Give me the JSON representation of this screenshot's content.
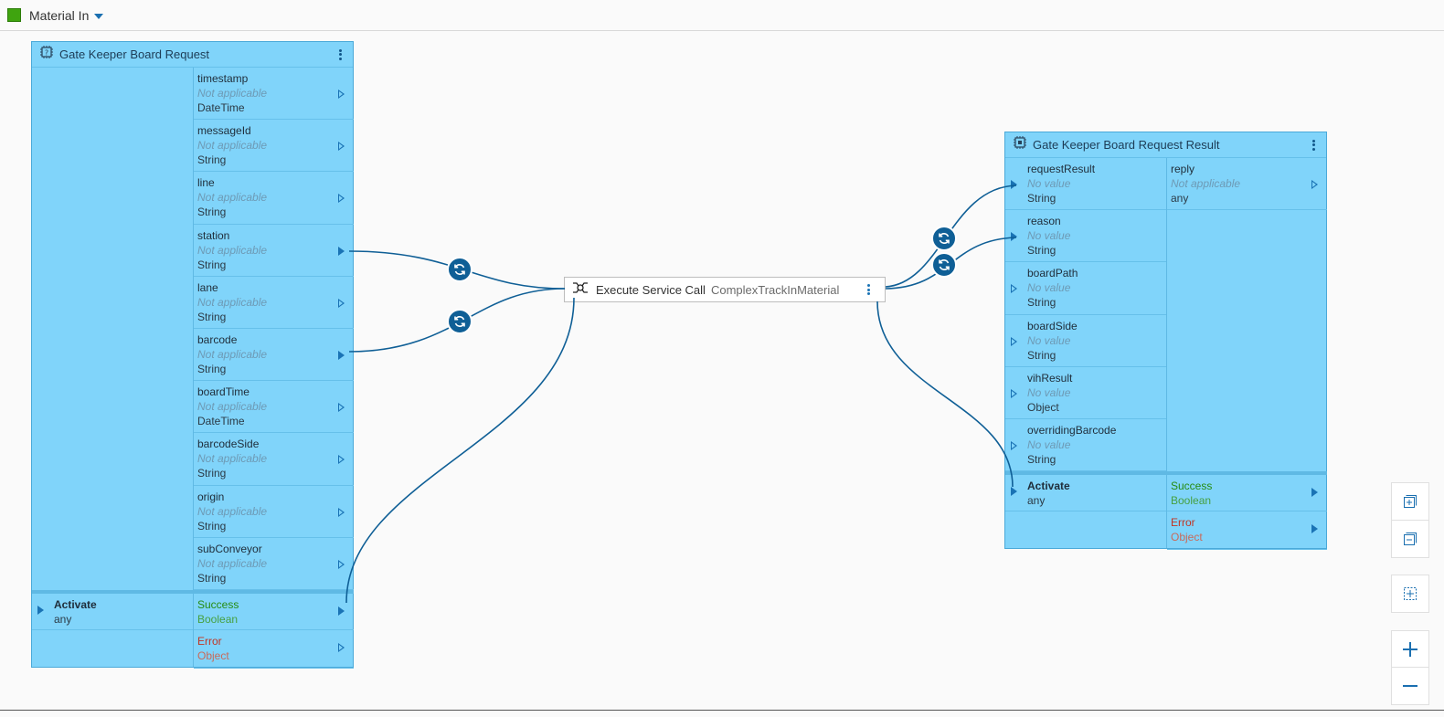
{
  "flow": {
    "name": "Material In",
    "swatch_color": "#3fa40f"
  },
  "left_task": {
    "title": "Gate Keeper Board Request",
    "outputs": [
      {
        "name": "timestamp",
        "value": "Not applicable",
        "type": "DateTime",
        "connected": false
      },
      {
        "name": "messageId",
        "value": "Not applicable",
        "type": "String",
        "connected": false
      },
      {
        "name": "line",
        "value": "Not applicable",
        "type": "String",
        "connected": false
      },
      {
        "name": "station",
        "value": "Not applicable",
        "type": "String",
        "connected": true
      },
      {
        "name": "lane",
        "value": "Not applicable",
        "type": "String",
        "connected": false
      },
      {
        "name": "barcode",
        "value": "Not applicable",
        "type": "String",
        "connected": true
      },
      {
        "name": "boardTime",
        "value": "Not applicable",
        "type": "DateTime",
        "connected": false
      },
      {
        "name": "barcodeSide",
        "value": "Not applicable",
        "type": "String",
        "connected": false
      },
      {
        "name": "origin",
        "value": "Not applicable",
        "type": "String",
        "connected": false
      },
      {
        "name": "subConveyor",
        "value": "Not applicable",
        "type": "String",
        "connected": false
      }
    ],
    "activate": {
      "name": "Activate",
      "type": "any"
    },
    "success": {
      "name": "Success",
      "type": "Boolean"
    },
    "error": {
      "name": "Error",
      "type": "Object"
    }
  },
  "service_call": {
    "name": "Execute Service Call",
    "reference": "ComplexTrackInMaterial"
  },
  "right_task": {
    "title": "Gate Keeper Board Request Result",
    "inputs": [
      {
        "name": "requestResult",
        "value": "No value",
        "type": "String",
        "connected": true
      },
      {
        "name": "reason",
        "value": "No value",
        "type": "String",
        "connected": true
      },
      {
        "name": "boardPath",
        "value": "No value",
        "type": "String",
        "connected": false
      },
      {
        "name": "boardSide",
        "value": "No value",
        "type": "String",
        "connected": false
      },
      {
        "name": "vihResult",
        "value": "No value",
        "type": "Object",
        "connected": false
      },
      {
        "name": "overridingBarcode",
        "value": "No value",
        "type": "String",
        "connected": false
      }
    ],
    "outputs": [
      {
        "name": "reply",
        "value": "Not applicable",
        "type": "any"
      }
    ],
    "activate": {
      "name": "Activate",
      "type": "any"
    },
    "success": {
      "name": "Success",
      "type": "Boolean"
    },
    "error": {
      "name": "Error",
      "type": "Object"
    }
  },
  "colors": {
    "task_fill": "#80d4fa",
    "wire": "#0f5f96",
    "success": "#268c12",
    "error": "#c03524"
  },
  "icons": {
    "task": "chip-icon",
    "service": "service-call-icon",
    "converter": "refresh-icon",
    "zoom_in": "plus-icon",
    "zoom_out": "minus-icon",
    "fit": "fit-to-screen-icon",
    "expand": "expand-all-icon",
    "collapse": "collapse-all-icon"
  }
}
